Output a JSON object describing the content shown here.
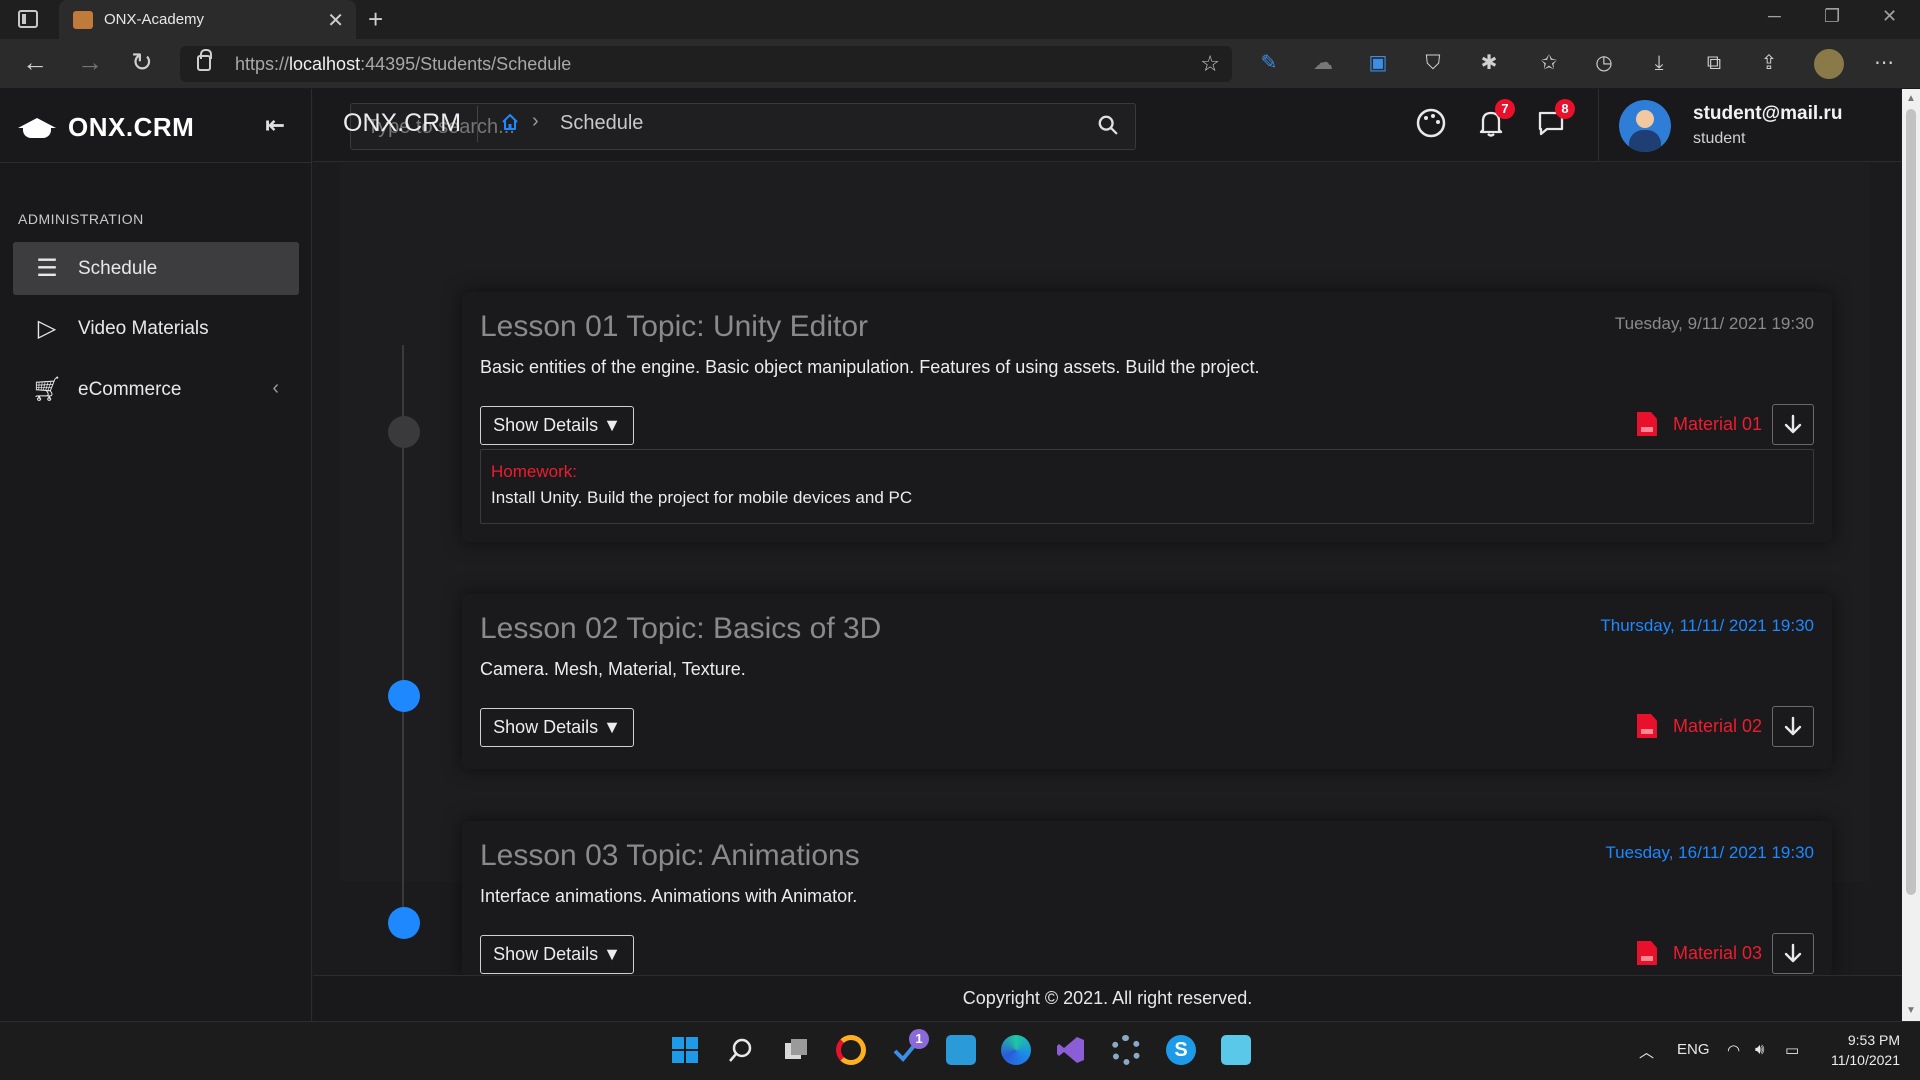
{
  "browser": {
    "tab_title": "ONX-Academy",
    "url_prefix": "https://",
    "url_host": "localhost",
    "url_path": ":44395/Students/Schedule"
  },
  "sidebar": {
    "brand": "ONX.CRM",
    "section_label": "ADMINISTRATION",
    "items": [
      {
        "label": "Schedule",
        "icon": "list-icon",
        "active": true
      },
      {
        "label": "Video Materials",
        "icon": "play-icon"
      },
      {
        "label": "eCommerce",
        "icon": "cart-icon"
      }
    ]
  },
  "topbar": {
    "search_placeholder": "Type to search...",
    "notifications_count": "7",
    "messages_count": "8",
    "user_email": "student@mail.ru",
    "user_role": "student"
  },
  "breadcrumb": {
    "title": "ONX.CRM",
    "current": "Schedule"
  },
  "colors": {
    "accent_blue": "#1e88ff",
    "accent_red": "#ee1c2e",
    "past_date_gray": "#8a8a8c"
  },
  "lessons": [
    {
      "title": "Lesson 01 Topic: Unity Editor",
      "date": "Tuesday, 9/11/ 2021 19:30",
      "description": "Basic entities of the engine. Basic object manipulation. Features of using assets. Build the project.",
      "details_label": "Show Details ▼",
      "material_label": "Material 01",
      "homework_label": "Homework:",
      "homework_text": "Install Unity. Build the project for mobile devices and PC"
    },
    {
      "title": "Lesson 02 Topic: Basics of 3D",
      "date": "Thursday, 11/11/ 2021 19:30",
      "description": "Camera. Mesh, Material, Texture.",
      "details_label": "Show Details ▼",
      "material_label": "Material 02"
    },
    {
      "title": "Lesson 03 Topic: Animations",
      "date": "Tuesday, 16/11/ 2021 19:30",
      "description": "Interface animations. Animations with Animator.",
      "details_label": "Show Details ▼",
      "material_label": "Material 03"
    }
  ],
  "footer": {
    "text": "Copyright © 2021. All right reserved."
  },
  "taskbar": {
    "lang": "ENG",
    "time": "9:53 PM",
    "date": "11/10/2021",
    "todo_badge": "1"
  }
}
